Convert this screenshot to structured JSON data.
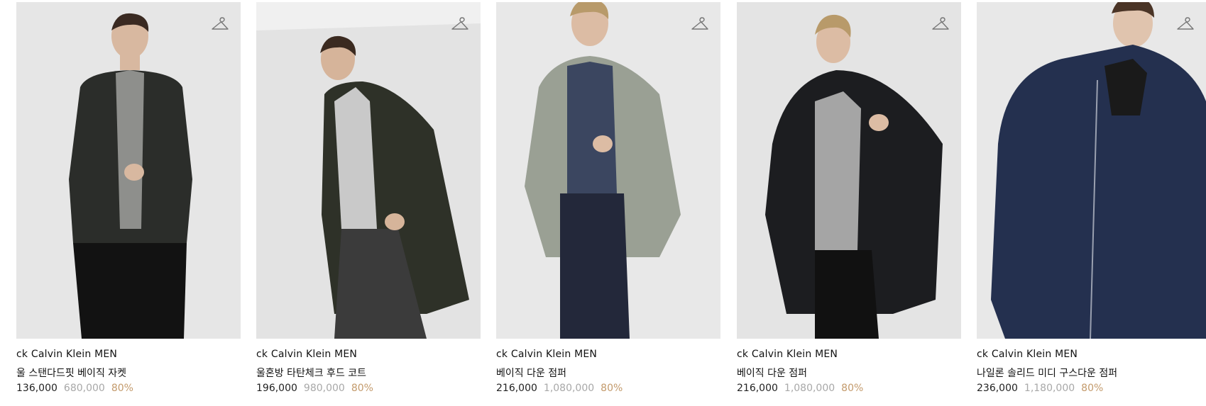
{
  "colors": {
    "discount": "#c39a6b",
    "original_price": "#a8a8a8",
    "photo_bg": "#e9e9e9"
  },
  "products": [
    {
      "brand": "ck Calvin Klein MEN",
      "name": "울 스탠다드핏 베이직 자켓",
      "price": "136,000",
      "original_price": "680,000",
      "discount": "80%",
      "icon": "hanger-icon",
      "garment_color": "#2b2d2a",
      "inner_color": "#8e8f8c"
    },
    {
      "brand": "ck Calvin Klein MEN",
      "name": "울혼방 타탄체크 후드 코트",
      "price": "196,000",
      "original_price": "980,000",
      "discount": "80%",
      "icon": "hanger-icon",
      "garment_color": "#2e3128",
      "inner_color": "#c9c9c9"
    },
    {
      "brand": "ck Calvin Klein MEN",
      "name": "베이직 다운 점퍼",
      "price": "216,000",
      "original_price": "1,080,000",
      "discount": "80%",
      "icon": "hanger-icon",
      "garment_color": "#9aa094",
      "inner_color": "#3b4660"
    },
    {
      "brand": "ck Calvin Klein MEN",
      "name": "베이직 다운 점퍼",
      "price": "216,000",
      "original_price": "1,080,000",
      "discount": "80%",
      "icon": "hanger-icon",
      "garment_color": "#1c1d20",
      "inner_color": "#a5a5a5"
    },
    {
      "brand": "ck Calvin Klein MEN",
      "name": "나일론 솔리드 미디 구스다운 점퍼",
      "price": "236,000",
      "original_price": "1,180,000",
      "discount": "80%",
      "icon": "hanger-icon",
      "garment_color": "#24304f",
      "inner_color": "#1a1a1a"
    }
  ]
}
